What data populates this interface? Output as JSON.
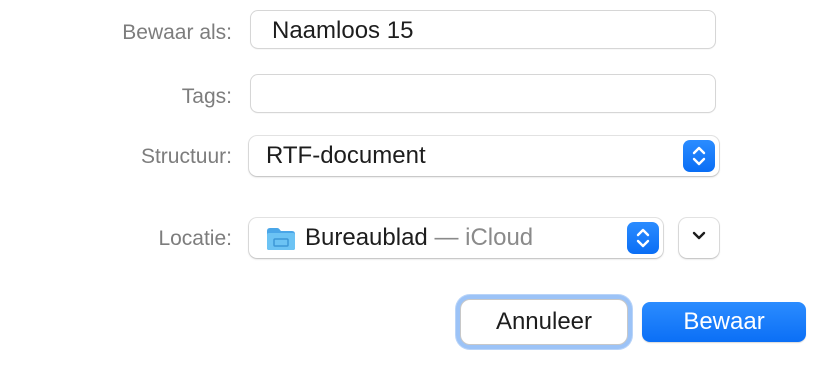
{
  "dialog": {
    "save_as": {
      "label": "Bewaar als:",
      "value": "Naamloos 15"
    },
    "tags": {
      "label": "Tags:",
      "value": ""
    },
    "format": {
      "label": "Structuur:",
      "value": "RTF-document"
    },
    "location": {
      "label": "Locatie:",
      "folder": "Bureaublad",
      "separator": "—",
      "service": "iCloud"
    },
    "buttons": {
      "cancel": "Annuleer",
      "save": "Bewaar"
    }
  },
  "colors": {
    "accent": "#0a6ef5",
    "focus_ring": "#9cc3f7",
    "label_text": "#7d7d7d",
    "folder": "#5ab4ee"
  },
  "icons": {
    "stepper": "up-down-chevron-icon",
    "folder": "folder-icon",
    "expand": "chevron-down-icon"
  }
}
